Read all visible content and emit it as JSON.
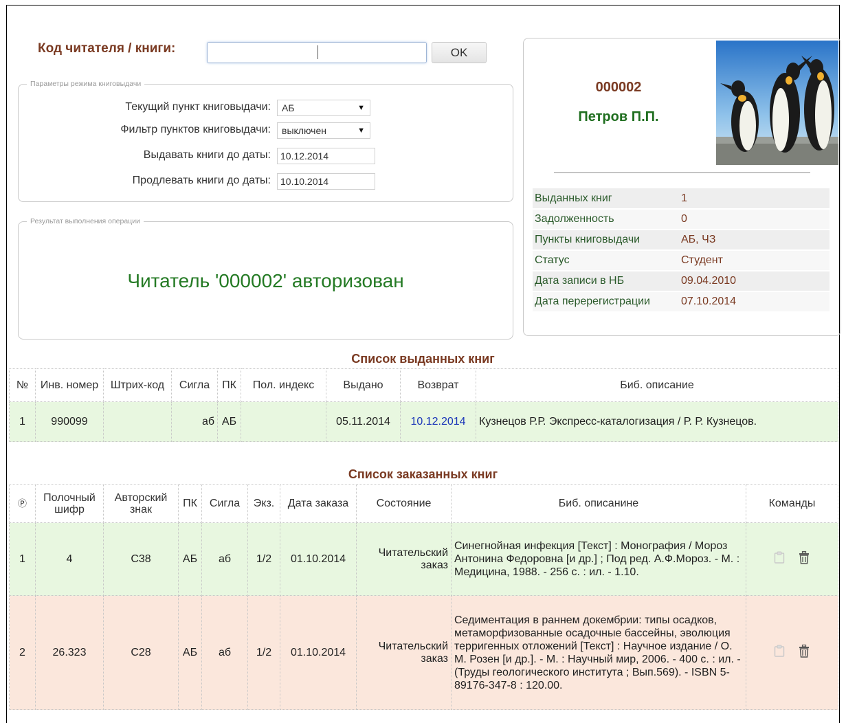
{
  "search": {
    "label": "Код читателя / книги:",
    "value": "",
    "ok_label": "OK"
  },
  "params": {
    "legend": "Параметры режима книговыдачи",
    "current_point_label": "Текущий пункт книговыдачи:",
    "current_point_value": "АБ",
    "filter_label": "Фильтр пунктов книговыдачи:",
    "filter_value": "выключен",
    "issue_until_label": "Выдавать книги до даты:",
    "issue_until_value": "10.12.2014",
    "extend_until_label": "Продлевать книги до даты:",
    "extend_until_value": "10.10.2014"
  },
  "result": {
    "legend": "Результат выполнения операции",
    "message": "Читатель '000002' авторизован"
  },
  "reader": {
    "code": "000002",
    "name": "Петров П.П.",
    "rows": [
      {
        "key": "Выданных книг",
        "value": "1"
      },
      {
        "key": "Задолженность",
        "value": "0"
      },
      {
        "key": "Пункты книговыдачи",
        "value": "АБ, ЧЗ"
      },
      {
        "key": "Статус",
        "value": "Студент"
      },
      {
        "key": "Дата записи в НБ",
        "value": "09.04.2010"
      },
      {
        "key": "Дата перерегистрации",
        "value": "07.10.2014"
      }
    ]
  },
  "issued": {
    "title": "Список выданных книг",
    "headers": {
      "num": "№",
      "inv": "Инв. номер",
      "barcode": "Штрих-код",
      "sigla": "Сигла",
      "pk": "ПК",
      "index": "Пол. индекс",
      "issued": "Выдано",
      "return": "Возврат",
      "desc": "Биб. описание"
    },
    "rows": [
      {
        "num": "1",
        "inv": "990099",
        "barcode": "",
        "sigla": "аб",
        "pk": "АБ",
        "index": "",
        "issued": "05.11.2014",
        "return": "10.12.2014",
        "desc": "Кузнецов Р.Р. Экспресс-каталогизация / Р. Р. Кузнецов."
      }
    ]
  },
  "ordered": {
    "title": "Список заказанных книг",
    "headers": {
      "num": "Ⓟ",
      "shelf": "Полочный шифр",
      "author": "Авторский знак",
      "pk": "ПК",
      "sigla": "Сигла",
      "copies": "Экз.",
      "date": "Дата заказа",
      "state": "Состояние",
      "desc": "Биб. описанине",
      "commands": "Команды"
    },
    "rows": [
      {
        "num": "1",
        "shelf": "4",
        "author": "С38",
        "pk": "АБ",
        "sigla": "аб",
        "copies": "1/2",
        "date": "01.10.2014",
        "state": "Читательский заказ",
        "desc": "Синегнойная инфекция [Текст] : Монография / Мороз Антонина Федоровна [и др.] ; Под ред. А.Ф.Мороз. - М. : Медицина, 1988. - 256 с. : ил. - 1.10."
      },
      {
        "num": "2",
        "shelf": "26.323",
        "author": "С28",
        "pk": "АБ",
        "sigla": "аб",
        "copies": "1/2",
        "date": "01.10.2014",
        "state": "Читательский заказ",
        "desc": "Седиментация в раннем докембрии: типы осадков, метаморфизованные осадочные бассейны, эволюция терригенных отложений [Текст] : Научное издание / О. М. Розен [и др.]. - М. : Научный мир, 2006. - 400 с. : ил. - (Труды геологического института ; Вып.569). - ISBN 5-89176-347-8 : 120.00."
      }
    ]
  },
  "icons": {
    "clipboard": "clipboard-icon",
    "trash": "trash-icon",
    "dropdown": "dropdown-arrow-icon"
  }
}
